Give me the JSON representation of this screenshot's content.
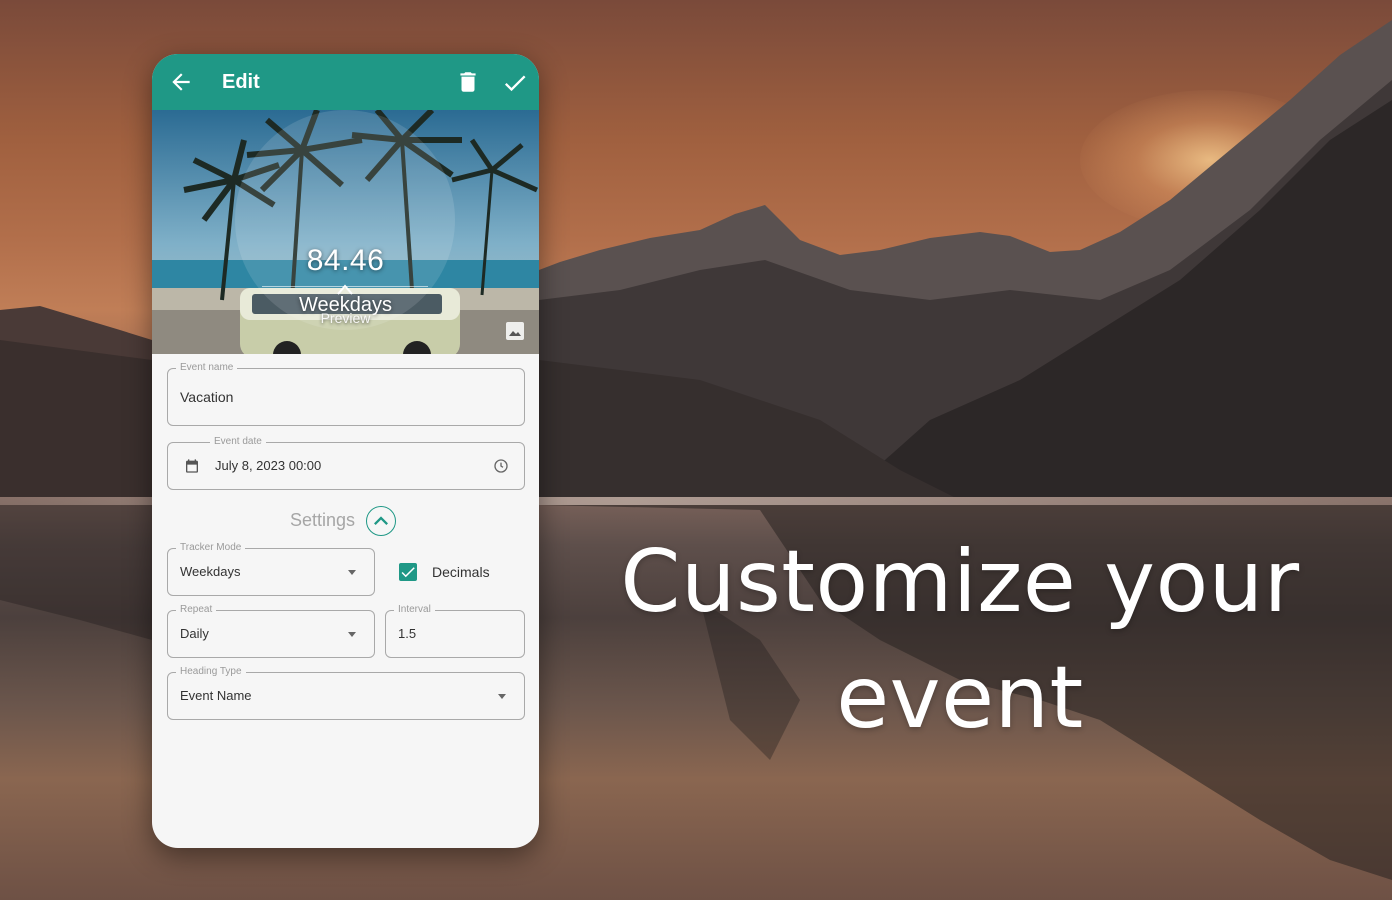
{
  "headline": {
    "line1": "Customize your",
    "line2": "event"
  },
  "app": {
    "title": "Edit",
    "icons": {
      "back": "arrow-left-icon",
      "delete": "trash-icon",
      "save": "check-icon"
    },
    "accent_color": "#1f9886"
  },
  "preview": {
    "counter_value": "84.46",
    "counter_unit": "Weekdays",
    "caption": "Preview",
    "image_button_icon": "image-icon"
  },
  "form": {
    "event_name": {
      "label": "Event name",
      "value": "Vacation"
    },
    "event_date": {
      "label": "Event date",
      "value": "July 8, 2023 00:00"
    },
    "settings": {
      "label": "Settings",
      "expanded": true
    },
    "tracker_mode": {
      "label": "Tracker Mode",
      "value": "Weekdays"
    },
    "decimals": {
      "label": "Decimals",
      "checked": true
    },
    "repeat": {
      "label": "Repeat",
      "value": "Daily"
    },
    "interval": {
      "label": "Interval",
      "value": "1.5"
    },
    "heading_type": {
      "label": "Heading Type",
      "value": "Event Name"
    }
  }
}
